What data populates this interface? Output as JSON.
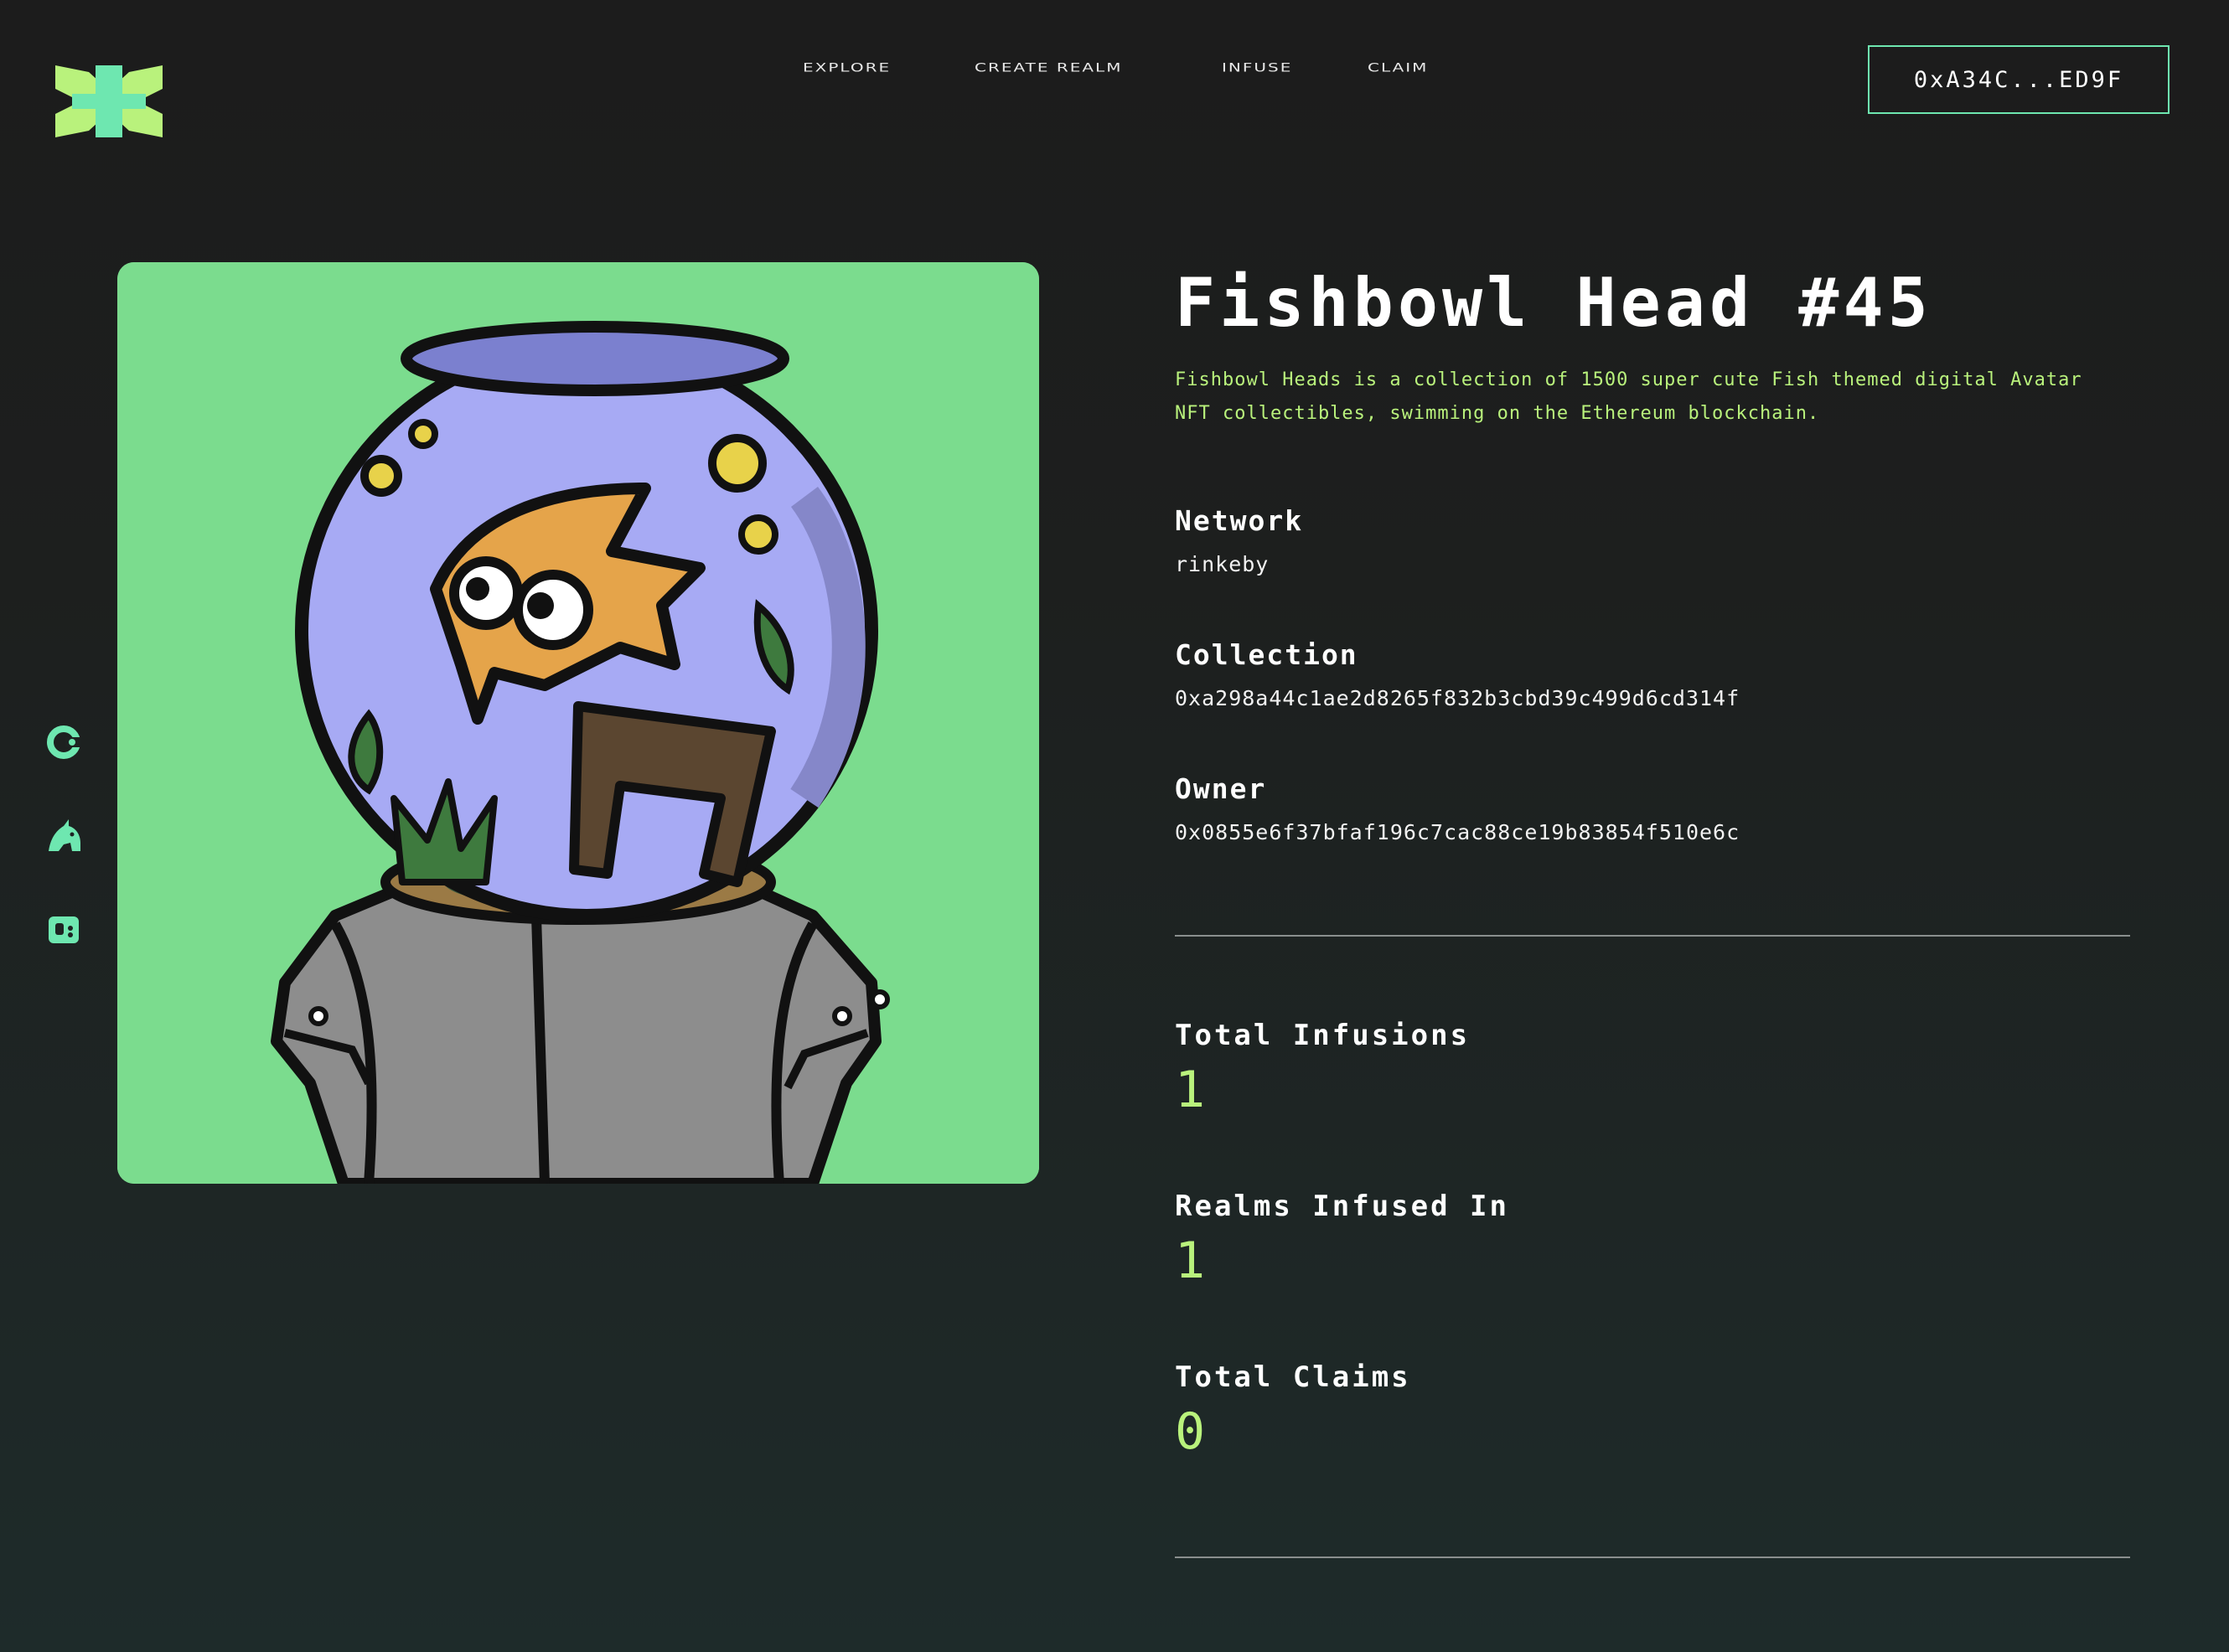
{
  "nav": {
    "items": [
      {
        "label": "EXPLORE"
      },
      {
        "label": "CREATE REALM"
      },
      {
        "label": "INFUSE"
      },
      {
        "label": "CLAIM"
      }
    ]
  },
  "wallet": {
    "address": "0xA34C...ED9F"
  },
  "socials": [
    {
      "icon": "opensea-c-icon"
    },
    {
      "icon": "unicorn-icon"
    },
    {
      "icon": "discord-icon"
    }
  ],
  "nft": {
    "title": "Fishbowl Head #45",
    "description": "Fishbowl Heads is a collection of 1500 super cute Fish themed digital Avatar NFT collectibles, swimming on the Ethereum blockchain.",
    "properties": [
      {
        "label": "Network",
        "value": "rinkeby"
      },
      {
        "label": "Collection",
        "value": "0xa298a44c1ae2d8265f832b3cbd39c499d6cd314f"
      },
      {
        "label": "Owner",
        "value": "0x0855e6f37bfaf196c7cac88ce19b83854f510e6c"
      }
    ],
    "stats": [
      {
        "label": "Total Infusions",
        "value": "1"
      },
      {
        "label": "Realms Infused In",
        "value": "1"
      },
      {
        "label": "Total Claims",
        "value": "0"
      }
    ]
  },
  "colors": {
    "accent_green": "#b9f27c",
    "accent_teal": "#6ee7b0",
    "card_bg": "#7bdc8e"
  }
}
